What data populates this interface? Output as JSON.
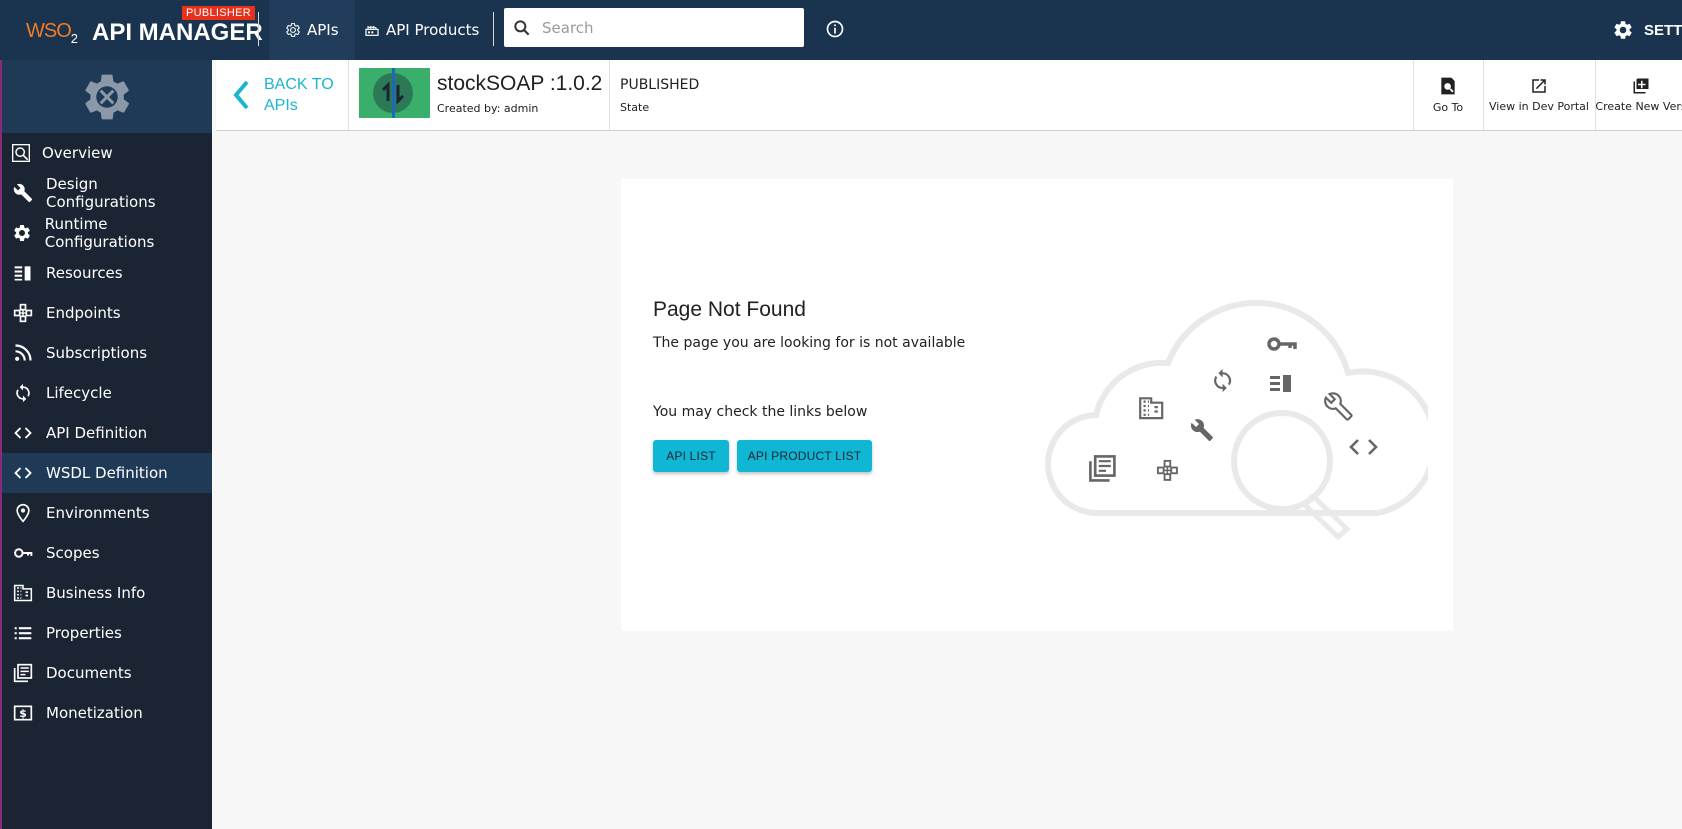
{
  "topbar": {
    "logo_prefix": "WSO",
    "logo_sub": "2",
    "logo_title": "API MANAGER",
    "badge": "PUBLISHER",
    "nav": [
      {
        "label": "APIs",
        "icon": "gear-icon"
      },
      {
        "label": "API Products",
        "icon": "api-products-icon"
      }
    ],
    "search": {
      "placeholder": "Search",
      "value": ""
    },
    "info_icon": "info-icon",
    "settings_label": "SETTIN"
  },
  "sidebar": {
    "header_icon": "gear-tools-icon",
    "items": [
      {
        "label": "Overview",
        "icon": "overview-icon"
      },
      {
        "label": "Design Configurations",
        "icon": "wrench-icon"
      },
      {
        "label": "Runtime Configurations",
        "icon": "gear-icon"
      },
      {
        "label": "Resources",
        "icon": "resources-icon"
      },
      {
        "label": "Endpoints",
        "icon": "endpoints-icon"
      },
      {
        "label": "Subscriptions",
        "icon": "rss-icon"
      },
      {
        "label": "Lifecycle",
        "icon": "refresh-icon"
      },
      {
        "label": "API Definition",
        "icon": "code-icon"
      },
      {
        "label": "WSDL Definition",
        "icon": "code-icon"
      },
      {
        "label": "Environments",
        "icon": "location-icon"
      },
      {
        "label": "Scopes",
        "icon": "key-icon"
      },
      {
        "label": "Business Info",
        "icon": "building-icon"
      },
      {
        "label": "Properties",
        "icon": "list-icon"
      },
      {
        "label": "Documents",
        "icon": "documents-icon"
      },
      {
        "label": "Monetization",
        "icon": "dollar-icon"
      }
    ],
    "active_index": 8
  },
  "api": {
    "back_line1": "BACK TO",
    "back_line2": "APIs",
    "name": "stockSOAP :1.0.2",
    "created_by": "Created by: admin",
    "state_value": "PUBLISHED",
    "state_label": "State",
    "actions": [
      {
        "label": "Go To",
        "icon": "search-document-icon"
      },
      {
        "label": "View in Dev Portal",
        "icon": "open-external-icon"
      },
      {
        "label": "Create New Vers",
        "icon": "add-box-icon"
      }
    ]
  },
  "not_found": {
    "title": "Page Not Found",
    "message": "The page you are looking for is not available",
    "check_links": "You may check the links below",
    "buttons": [
      "API LIST",
      "API PRODUCT LIST"
    ]
  },
  "colors": {
    "topbar": "#1a3450",
    "sidebar": "#1a2433",
    "accent": "#10b7d4",
    "badge": "#e8311a"
  }
}
